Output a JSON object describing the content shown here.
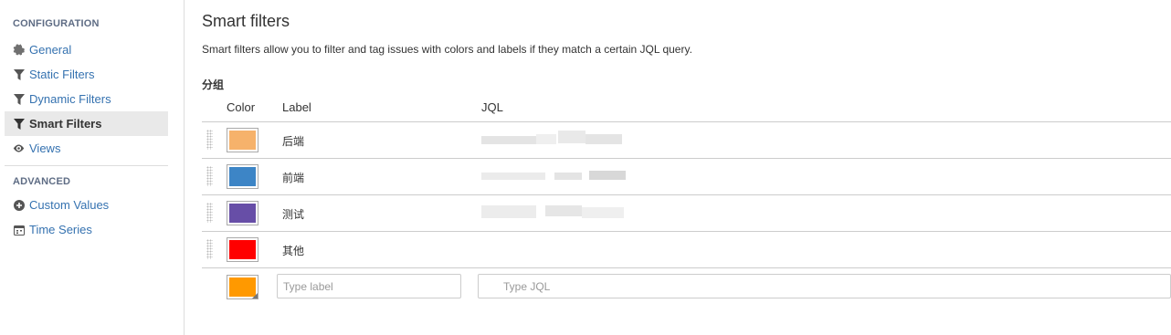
{
  "sidebar": {
    "configuration_title": "CONFIGURATION",
    "advanced_title": "ADVANCED",
    "config_items": [
      {
        "label": "General",
        "icon": "gear-icon"
      },
      {
        "label": "Static Filters",
        "icon": "funnel-icon"
      },
      {
        "label": "Dynamic Filters",
        "icon": "funnel-icon"
      },
      {
        "label": "Smart Filters",
        "icon": "funnel-icon",
        "active": true
      },
      {
        "label": "Views",
        "icon": "eye-icon"
      }
    ],
    "advanced_items": [
      {
        "label": "Custom Values",
        "icon": "plus-circle-icon"
      },
      {
        "label": "Time Series",
        "icon": "calendar-icon"
      }
    ]
  },
  "main": {
    "title": "Smart filters",
    "description": "Smart filters allow you to filter and tag issues with colors and labels if they match a certain JQL query.",
    "group_name": "分组",
    "columns": {
      "color": "Color",
      "label": "Label",
      "jql": "JQL"
    },
    "rows": [
      {
        "label": "后端",
        "color": "#f6b26b"
      },
      {
        "label": "前端",
        "color": "#3d85c6"
      },
      {
        "label": "测试",
        "color": "#674ea7"
      },
      {
        "label": "其他",
        "color": "#ff0000"
      }
    ],
    "new_row": {
      "color": "#ff9900",
      "label_placeholder": "Type label",
      "jql_placeholder": "Type JQL"
    }
  }
}
